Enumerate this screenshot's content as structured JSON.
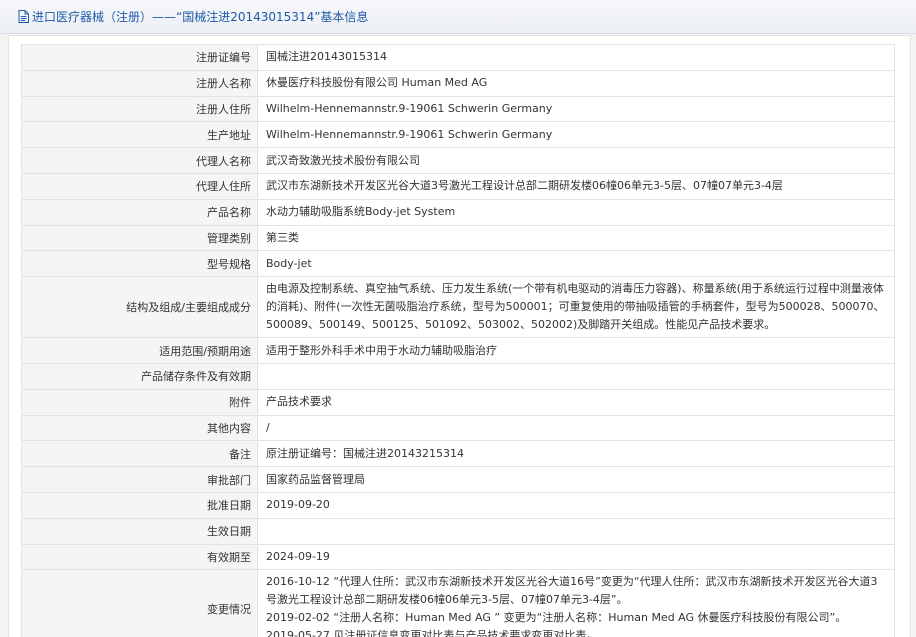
{
  "header": {
    "title": "进口医疗器械（注册）——“国械注进20143015314”基本信息",
    "icon": "document-icon"
  },
  "rows": [
    {
      "label": "注册证编号",
      "value": "国械注进20143015314"
    },
    {
      "label": "注册人名称",
      "value": "休曼医疗科技股份有限公司 Human Med AG"
    },
    {
      "label": "注册人住所",
      "value": "Wilhelm-Hennemannstr.9-19061 Schwerin Germany"
    },
    {
      "label": "生产地址",
      "value": "Wilhelm-Hennemannstr.9-19061 Schwerin Germany"
    },
    {
      "label": "代理人名称",
      "value": "武汉奇致激光技术股份有限公司"
    },
    {
      "label": "代理人住所",
      "value": "武汉市东湖新技术开发区光谷大道3号激光工程设计总部二期研发楼06幢06单元3-5层、07幢07单元3-4层"
    },
    {
      "label": "产品名称",
      "value": "水动力辅助吸脂系统Body-jet System"
    },
    {
      "label": "管理类别",
      "value": "第三类"
    },
    {
      "label": "型号规格",
      "value": "Body-jet"
    },
    {
      "label": "结构及组成/主要组成成分",
      "value": "由电源及控制系统、真空抽气系统、压力发生系统(一个带有机电驱动的消毒压力容器)、称量系统(用于系统运行过程中测量液体的消耗)、附件(一次性无菌吸脂治疗系统，型号为500001；可重复使用的带抽吸插管的手柄套件，型号为500028、500070、500089、500149、500125、501092、503002、502002)及脚踏开关组成。性能见产品技术要求。",
      "tall": true
    },
    {
      "label": "适用范围/预期用途",
      "value": "适用于整形外科手术中用于水动力辅助吸脂治疗"
    },
    {
      "label": "产品储存条件及有效期",
      "value": ""
    },
    {
      "label": "附件",
      "value": "产品技术要求"
    },
    {
      "label": "其他内容",
      "value": "/"
    },
    {
      "label": "备注",
      "value": "原注册证编号：国械注进20143215314"
    },
    {
      "label": "审批部门",
      "value": "国家药品监督管理局"
    },
    {
      "label": "批准日期",
      "value": "2019-09-20"
    },
    {
      "label": "生效日期",
      "value": ""
    },
    {
      "label": "有效期至",
      "value": "2024-09-19"
    }
  ],
  "change_log": {
    "label": "变更情况",
    "entries": [
      "2016-10-12 “代理人住所：武汉市东湖新技术开发区光谷大道16号”变更为“代理人住所：武汉市东湖新技术开发区光谷大道3号激光工程设计总部二期研发楼06幢06单元3-5层、07幢07单元3-4层”。",
      "2019-02-02 “注册人名称：Human Med AG ” 变更为“注册人名称：Human Med AG 休曼医疗科技股份有限公司”。",
      "2019-05-27 见注册证信息变更对比表与产品技术要求变更对比表。"
    ]
  }
}
